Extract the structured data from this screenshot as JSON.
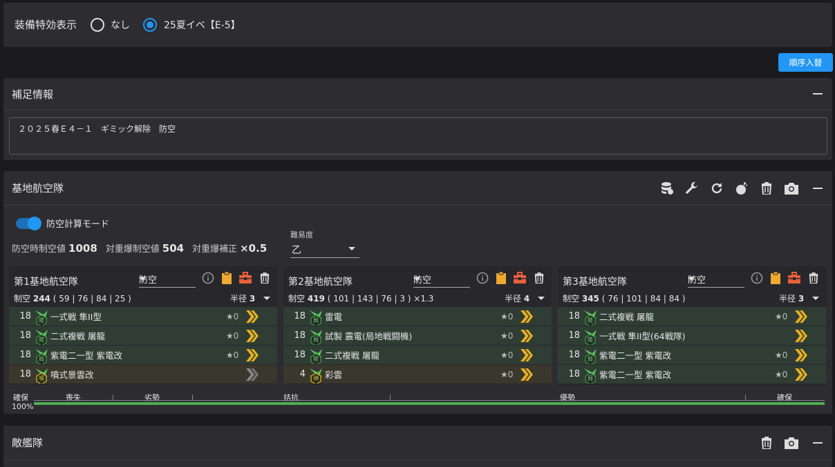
{
  "top": {
    "label": "装備特効表示",
    "opt_none": "なし",
    "opt_event": "25夏イベ【E-5】"
  },
  "reorder_button": "順序入替",
  "hokan": {
    "title": "補足情報",
    "text": "２０２５春Ｅ４－１　ギミック解除　防空"
  },
  "base": {
    "title": "基地航空隊",
    "toggle_label": "防空計算モード",
    "stats_label1": "防空時制空値",
    "stats_value1": "1008",
    "stats_label2": "対重爆制空値",
    "stats_value2": "504",
    "stats_label3": "対重爆補正",
    "stats_value3": "×0.5",
    "difficulty_label": "難易度",
    "difficulty_value": "乙",
    "corps": [
      {
        "title": "第1基地航空隊",
        "mode": "防空",
        "seiku_label": "制空",
        "seiku": "244",
        "detail": "( 59 | 76 | 84 | 25 )",
        "radius_label": "半径",
        "radius": "3",
        "slots": [
          {
            "lv": "18",
            "name": "一式戦 隼II型",
            "star": "★0",
            "badge": "陸",
            "badge_color": "#3a8a3a"
          },
          {
            "lv": "18",
            "name": "二式複戦 屠龍",
            "star": "★0",
            "badge": "陸",
            "badge_color": "#3a8a3a"
          },
          {
            "lv": "18",
            "name": "紫電二一型 紫電改",
            "star": "★0",
            "badge": "局",
            "badge_color": "#3a8a3a"
          },
          {
            "lv": "18",
            "name": "噴式景雲改",
            "star": "",
            "badge": "噴",
            "badge_color": "#c8a020"
          }
        ]
      },
      {
        "title": "第2基地航空隊",
        "mode": "防空",
        "seiku_label": "制空",
        "seiku": "419",
        "detail": "( 101 | 143 | 76 | 3 ) ×1.3",
        "radius_label": "半径",
        "radius": "4",
        "slots": [
          {
            "lv": "18",
            "name": "雷電",
            "star": "★0",
            "badge": "局",
            "badge_color": "#3a8a3a"
          },
          {
            "lv": "18",
            "name": "試製 震電(局地戦闘機)",
            "star": "★0",
            "badge": "局",
            "badge_color": "#3a8a3a"
          },
          {
            "lv": "18",
            "name": "二式複戦 屠龍",
            "star": "★0",
            "badge": "陸",
            "badge_color": "#3a8a3a"
          },
          {
            "lv": "4",
            "name": "彩雲",
            "star": "★0",
            "badge": "偵",
            "badge_color": "#c8a020"
          }
        ]
      },
      {
        "title": "第3基地航空隊",
        "mode": "防空",
        "seiku_label": "制空",
        "seiku": "345",
        "detail": "( 76 | 101 | 84 | 84 )",
        "radius_label": "半径",
        "radius": "3",
        "slots": [
          {
            "lv": "18",
            "name": "二式複戦 屠龍",
            "star": "★0",
            "badge": "陸",
            "badge_color": "#3a8a3a"
          },
          {
            "lv": "18",
            "name": "一式戦 隼II型(64戦隊)",
            "star": "",
            "badge": "陸",
            "badge_color": "#3a8a3a"
          },
          {
            "lv": "18",
            "name": "紫電二一型 紫電改",
            "star": "★0",
            "badge": "局",
            "badge_color": "#3a8a3a"
          },
          {
            "lv": "18",
            "name": "紫電二一型 紫電改",
            "star": "★0",
            "badge": "局",
            "badge_color": "#3a8a3a"
          }
        ]
      }
    ],
    "gauge": {
      "left_label": "確保",
      "percent": "100%",
      "lost": "喪失",
      "inferior": "劣勢",
      "parity": "拮抗",
      "superior": "優勢",
      "supremacy": "確保"
    }
  },
  "enemy": {
    "title": "敵艦隊"
  },
  "colors": {
    "accent": "#2196f3",
    "slot_bg": "#2f3d35",
    "slot_bg_last": "#3a372d",
    "gold": "#e8b020",
    "gauge_green": "#4caf50"
  }
}
